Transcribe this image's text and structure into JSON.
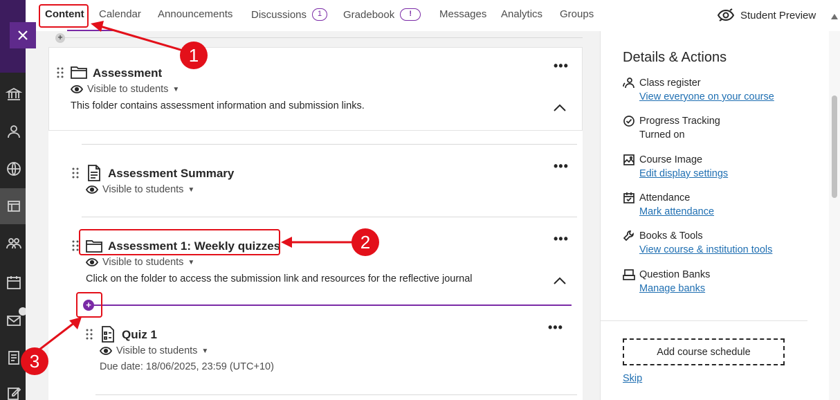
{
  "tabs": [
    {
      "label": "Content"
    },
    {
      "label": "Calendar"
    },
    {
      "label": "Announcements"
    },
    {
      "label": "Discussions",
      "count": "1"
    },
    {
      "label": "Gradebook",
      "count": "!"
    },
    {
      "label": "Messages"
    },
    {
      "label": "Analytics"
    },
    {
      "label": "Groups"
    }
  ],
  "student_preview": "Student Preview",
  "items": {
    "assessment": {
      "title": "Assessment",
      "visibility": "Visible to students",
      "description": "This folder contains assessment information and submission links."
    },
    "summary": {
      "title": "Assessment Summary",
      "visibility": "Visible to students"
    },
    "weekly": {
      "title": "Assessment 1: Weekly quizzes",
      "visibility": "Visible to students",
      "description": "Click on the folder to access the submission link and resources for the reflective journal"
    },
    "quiz": {
      "title": "Quiz 1",
      "visibility": "Visible to students",
      "due": "Due date: 18/06/2025, 23:59 (UTC+10)"
    }
  },
  "details": {
    "title": "Details & Actions",
    "items": [
      {
        "icon": "people-icon",
        "label": "Class register",
        "sub": "View everyone on your course"
      },
      {
        "icon": "check-circle-icon",
        "label": "Progress Tracking",
        "sub": "Turned on"
      },
      {
        "icon": "image-icon",
        "label": "Course Image",
        "sub": "Edit display settings"
      },
      {
        "icon": "calendar-check-icon",
        "label": "Attendance",
        "sub": "Mark attendance"
      },
      {
        "icon": "wrench-icon",
        "label": "Books & Tools",
        "sub": "View course & institution tools"
      },
      {
        "icon": "bank-icon",
        "label": "Question Banks",
        "sub": "Manage banks"
      }
    ],
    "schedule_button": "Add course schedule",
    "skip": "Skip"
  },
  "callouts": [
    "1",
    "2",
    "3"
  ],
  "colors": {
    "accent": "#7a2aa6",
    "annotation": "#e3101a",
    "link": "#1f6fb2",
    "nav": "#262626"
  }
}
